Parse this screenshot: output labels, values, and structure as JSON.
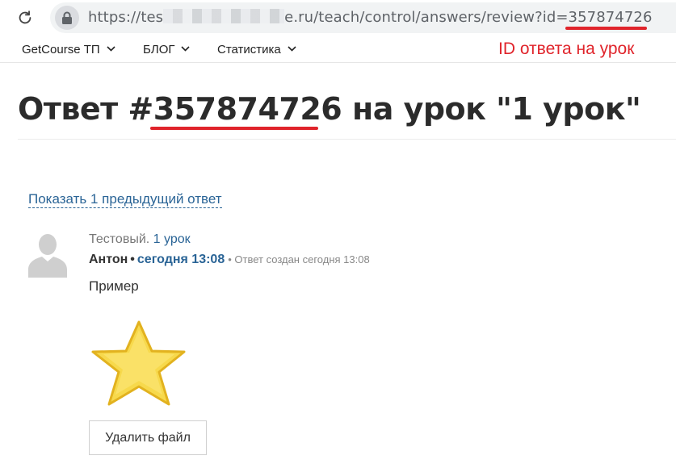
{
  "browser": {
    "url_prefix": "https://tes",
    "url_middle": "e.ru/teach/control/answers/review?id=",
    "url_id": "357874726"
  },
  "menu": {
    "items": [
      {
        "label": "GetCourse ТП"
      },
      {
        "label": "БЛОГ"
      },
      {
        "label": "Статистика"
      }
    ]
  },
  "annotation": "ID ответа на урок",
  "page": {
    "title_prefix": "Ответ #",
    "title_id": "357874726",
    "title_suffix": " на урок \"1 урок\""
  },
  "answer": {
    "prev_link": "Показать 1 предыдущий ответ",
    "lesson_prefix": "Тестовый. ",
    "lesson_link": "1 урок",
    "author": "Антон",
    "separator": "•",
    "time": "сегодня 13:08",
    "meta": "• Ответ создан сегодня 13:08",
    "text": "Пример",
    "delete_button": "Удалить файл"
  },
  "colors": {
    "accent_red": "#e0242b",
    "link_blue": "#2a6496",
    "star_fill": "#f7d94c"
  }
}
